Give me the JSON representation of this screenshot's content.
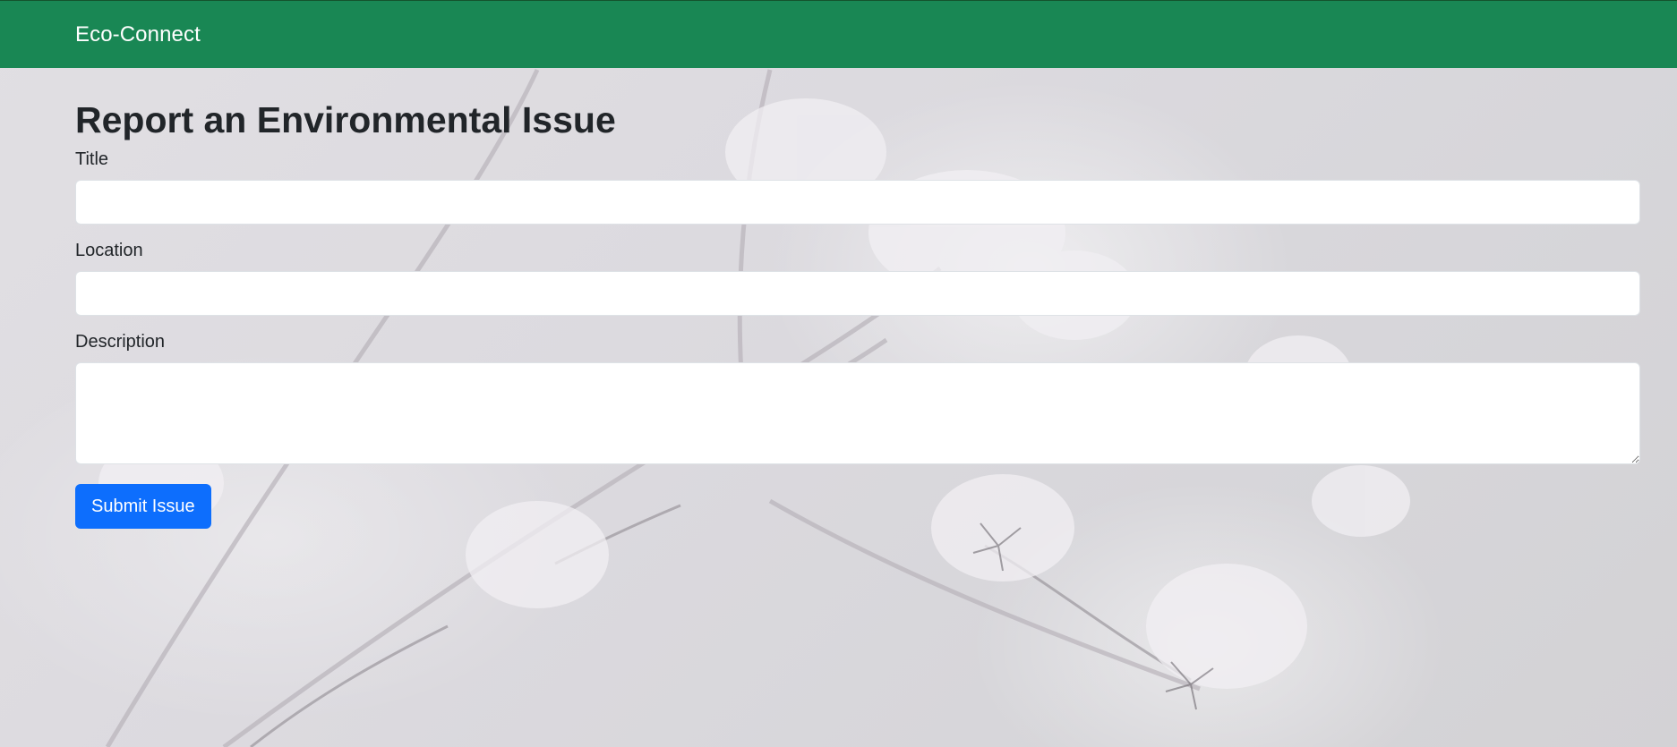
{
  "navbar": {
    "brand": "Eco-Connect",
    "background_color": "#198754"
  },
  "main": {
    "title": "Report an Environmental Issue",
    "fields": {
      "title": {
        "label": "Title",
        "value": ""
      },
      "location": {
        "label": "Location",
        "value": ""
      },
      "description": {
        "label": "Description",
        "value": ""
      }
    },
    "submit_button": {
      "label": "Submit Issue",
      "color": "#0d6efd"
    }
  },
  "background": {
    "description_icon": "frost-covered-plant-photo"
  }
}
